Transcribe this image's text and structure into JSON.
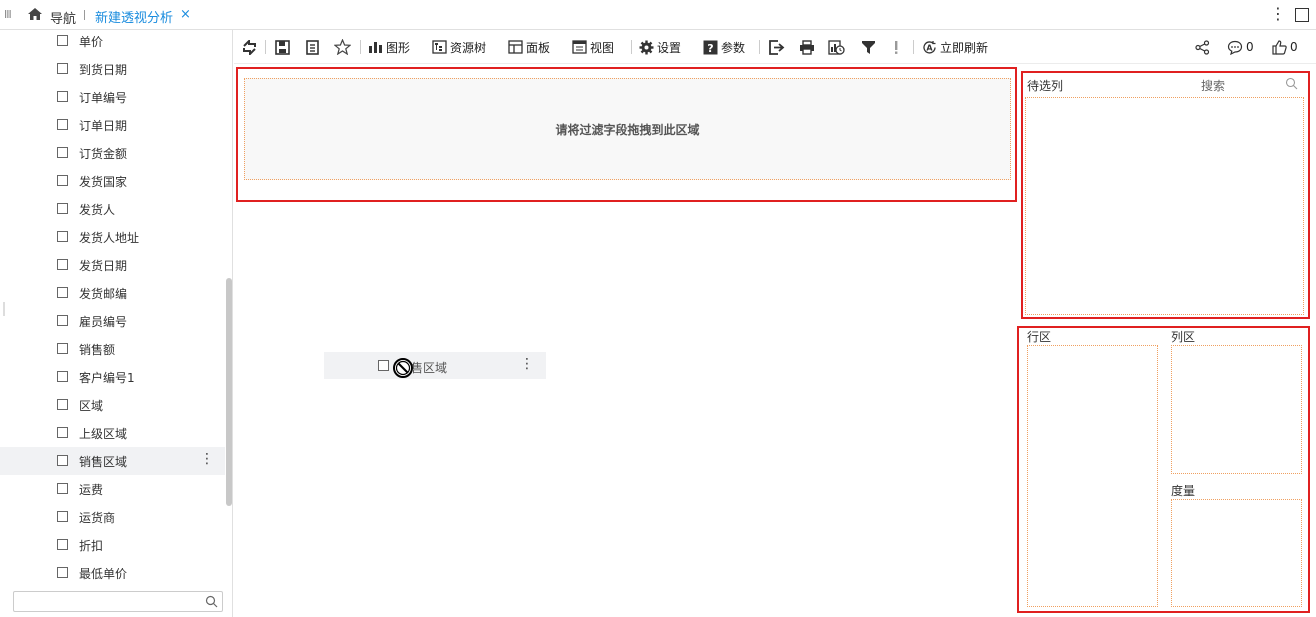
{
  "tabbar": {
    "home_label": "导航",
    "active_tab_label": "新建透视分析",
    "close_glyph": "×",
    "menu_glyph": "III"
  },
  "left_panel": {
    "fields": [
      {
        "label": "单价"
      },
      {
        "label": "到货日期"
      },
      {
        "label": "订单编号"
      },
      {
        "label": "订单日期"
      },
      {
        "label": "订货金额"
      },
      {
        "label": "发货国家"
      },
      {
        "label": "发货人"
      },
      {
        "label": "发货人地址"
      },
      {
        "label": "发货日期"
      },
      {
        "label": "发货邮编"
      },
      {
        "label": "雇员编号"
      },
      {
        "label": "销售额"
      },
      {
        "label": "客户编号1"
      },
      {
        "label": "区域"
      },
      {
        "label": "上级区域"
      },
      {
        "label": "销售区域",
        "highlighted": true
      },
      {
        "label": "运费"
      },
      {
        "label": "运货商"
      },
      {
        "label": "折扣"
      },
      {
        "label": "最低单价"
      }
    ],
    "search_placeholder": ""
  },
  "toolbar": {
    "chart_label": "图形",
    "resource_tree_label": "资源树",
    "panel_label": "面板",
    "view_label": "视图",
    "settings_label": "设置",
    "params_label": "参数",
    "refresh_now_label": "立即刷新",
    "comment_count": "0",
    "like_count": "0"
  },
  "canvas": {
    "filter_drop_text": "请将过滤字段拖拽到此区域",
    "drag_ghost_label": "售区域"
  },
  "right_panel": {
    "candidates_title": "待选列",
    "search_label": "搜索",
    "row_zone_label": "行区",
    "column_zone_label": "列区",
    "measure_zone_label": "度量"
  },
  "colors": {
    "accent": "#1a8cde",
    "highlight_border": "#e02020",
    "dropzone_border": "#f0a060"
  }
}
